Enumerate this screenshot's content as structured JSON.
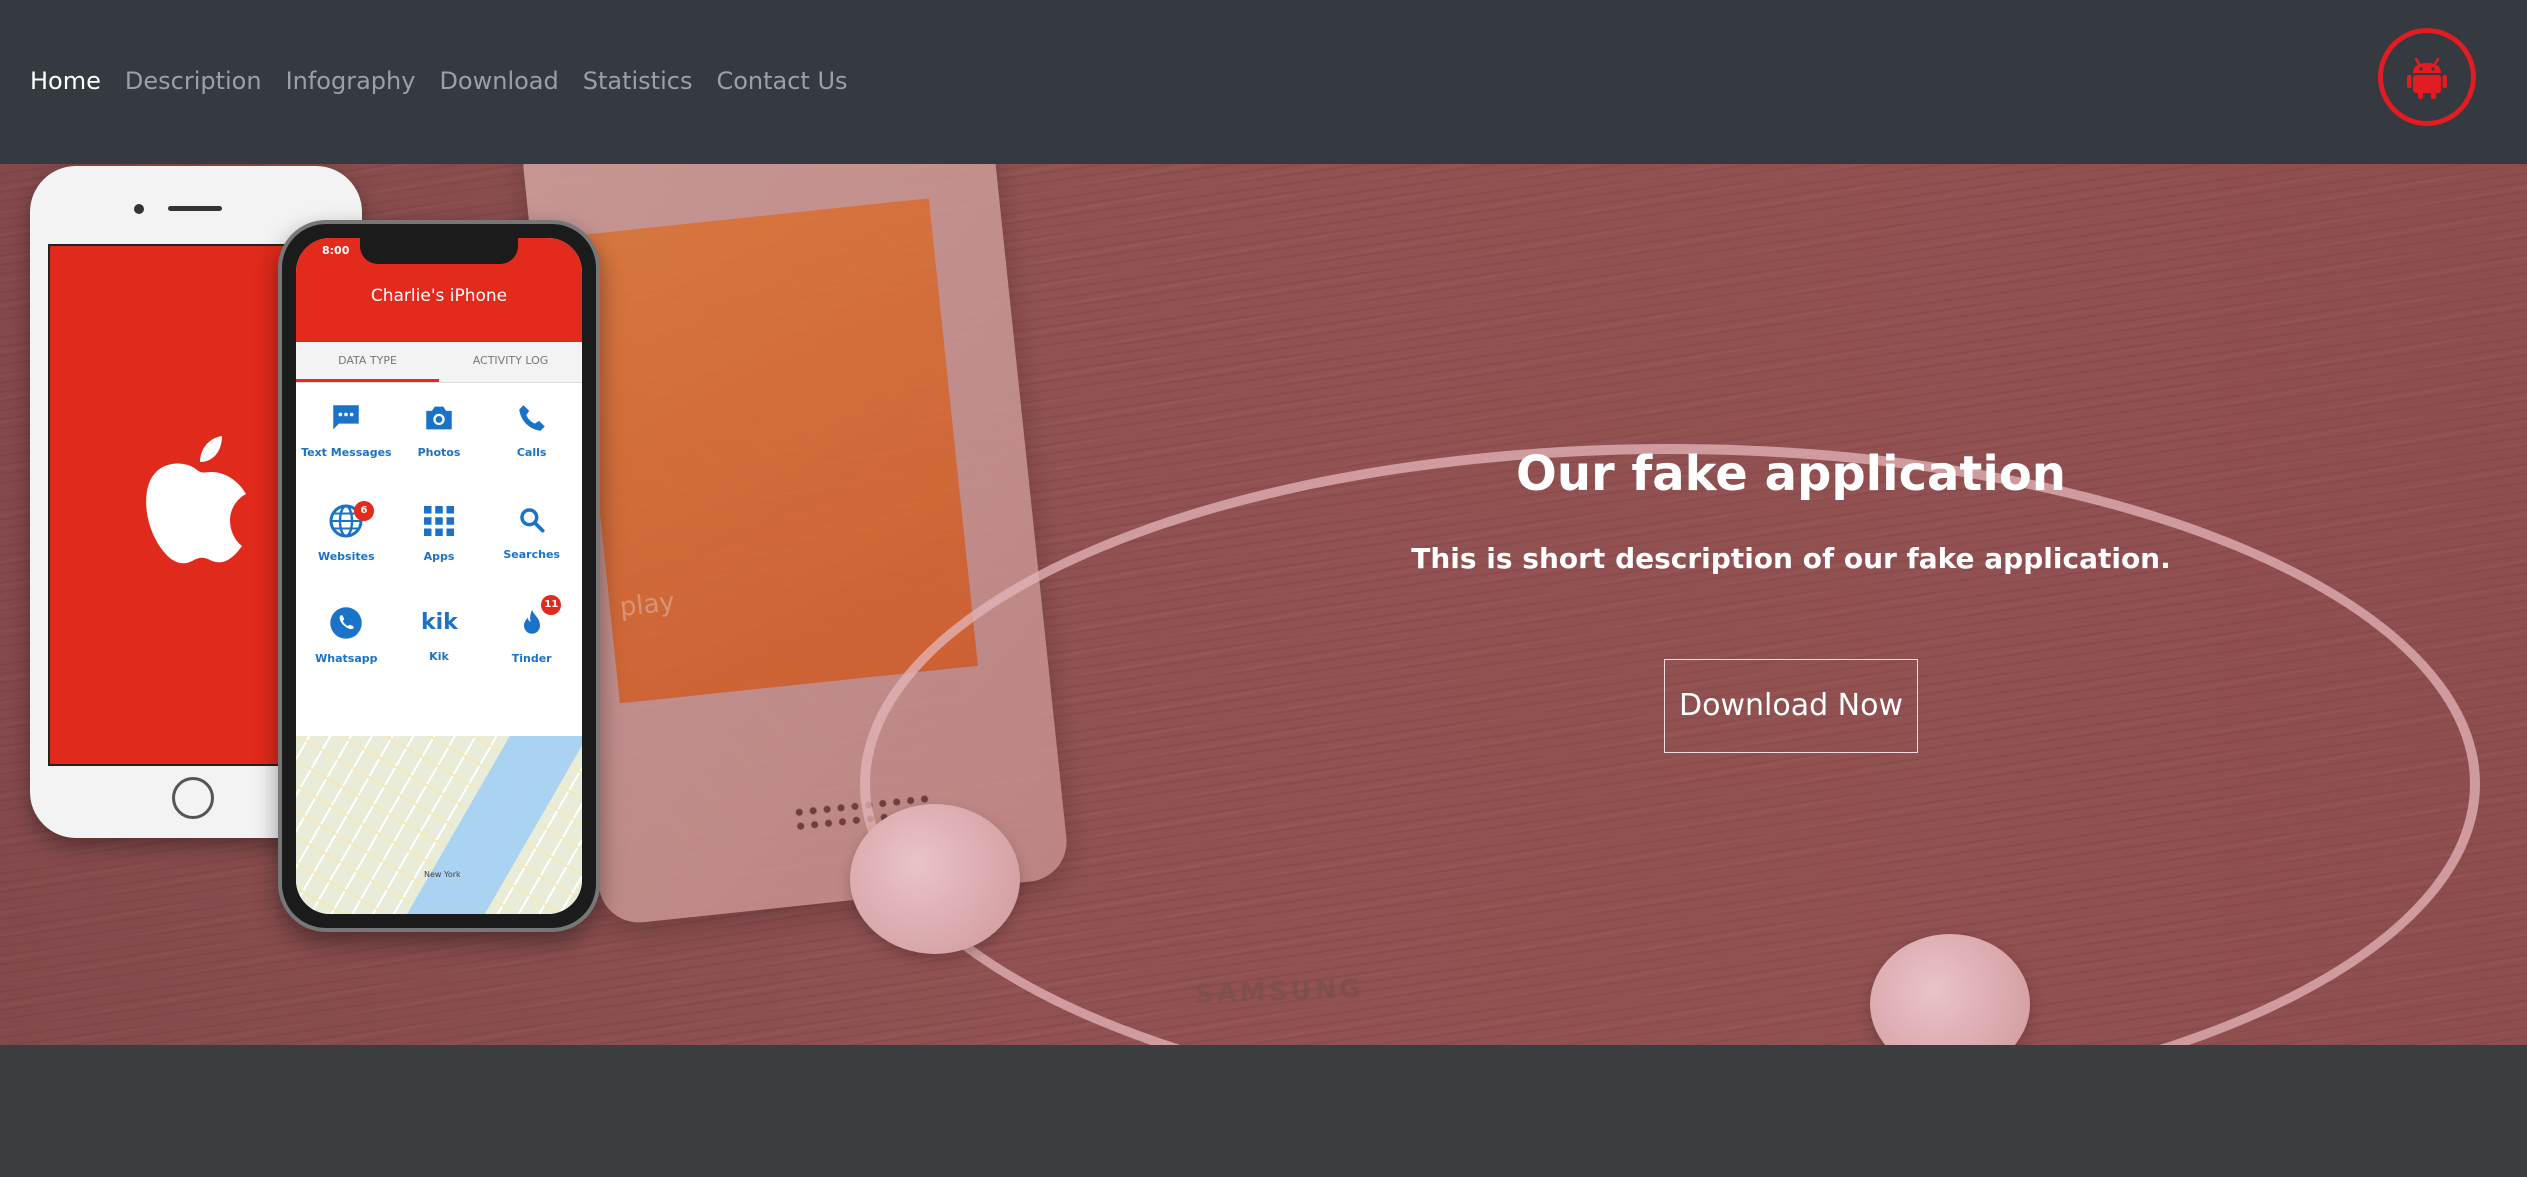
{
  "nav": {
    "items": [
      {
        "label": "Home",
        "active": true
      },
      {
        "label": "Description",
        "active": false
      },
      {
        "label": "Infography",
        "active": false
      },
      {
        "label": "Download",
        "active": false
      },
      {
        "label": "Statistics",
        "active": false
      },
      {
        "label": "Contact Us",
        "active": false
      }
    ],
    "right_icon": "android-icon",
    "accent": "#e31b23"
  },
  "hero": {
    "title": "Our fake application",
    "description": "This is short description of our fake application.",
    "button_label": "Download Now",
    "phone_mockup": {
      "time": "8:00",
      "title": "Charlie's iPhone",
      "tabs": [
        "DATA TYPE",
        "ACTIVITY LOG"
      ],
      "apps": [
        {
          "label": "Text Messages",
          "icon": "message-icon"
        },
        {
          "label": "Photos",
          "icon": "camera-icon"
        },
        {
          "label": "Calls",
          "icon": "phone-icon"
        },
        {
          "label": "Websites",
          "icon": "globe-icon",
          "badge": "6"
        },
        {
          "label": "Apps",
          "icon": "grid-icon"
        },
        {
          "label": "Searches",
          "icon": "search-icon"
        },
        {
          "label": "Whatsapp",
          "icon": "whatsapp-icon"
        },
        {
          "label": "Kik",
          "icon": "kik-icon"
        },
        {
          "label": "Tinder",
          "icon": "flame-icon",
          "badge": "11"
        }
      ],
      "map_label": "New York"
    },
    "background_text": {
      "play": "play",
      "brand": "SAMSUNG"
    }
  },
  "colors": {
    "navbar": "#353940",
    "brand_red": "#e22a1d",
    "footer": "#3b3d40"
  }
}
